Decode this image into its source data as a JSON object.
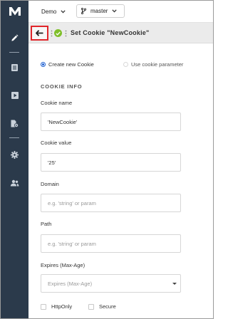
{
  "app": {
    "logo": "M"
  },
  "sidebar": {
    "items": [
      {
        "icon": "pencil-icon",
        "active": true
      },
      {
        "icon": "document-list-icon"
      },
      {
        "icon": "play-icon"
      },
      {
        "icon": "file-settings-icon"
      },
      {
        "icon": "gear-icon"
      },
      {
        "icon": "users-icon"
      }
    ]
  },
  "topbar": {
    "project": "Demo",
    "branch": "master"
  },
  "titlebar": {
    "title": "Set Cookie \"NewCookie\"",
    "status_color": "#7fbf2a",
    "back_highlight_color": "#e0262b"
  },
  "mode": {
    "options": [
      {
        "label": "Create new Cookie",
        "selected": true
      },
      {
        "label": "Use cookie parameter",
        "selected": false
      }
    ]
  },
  "form": {
    "section": "COOKIE INFO",
    "cookie_name": {
      "label": "Cookie name",
      "value": "'NewCookie'"
    },
    "cookie_value": {
      "label": "Cookie value",
      "value": "'25'"
    },
    "domain": {
      "label": "Domain",
      "placeholder": "e.g. 'string' or param"
    },
    "path": {
      "label": "Path",
      "placeholder": "e.g. 'string' or param"
    },
    "expires": {
      "label": "Expires (Max-Age)",
      "placeholder": "Expires (Max-Age)"
    },
    "http_only": {
      "label": "HttpOnly",
      "checked": false
    },
    "secure": {
      "label": "Secure",
      "checked": false
    }
  }
}
